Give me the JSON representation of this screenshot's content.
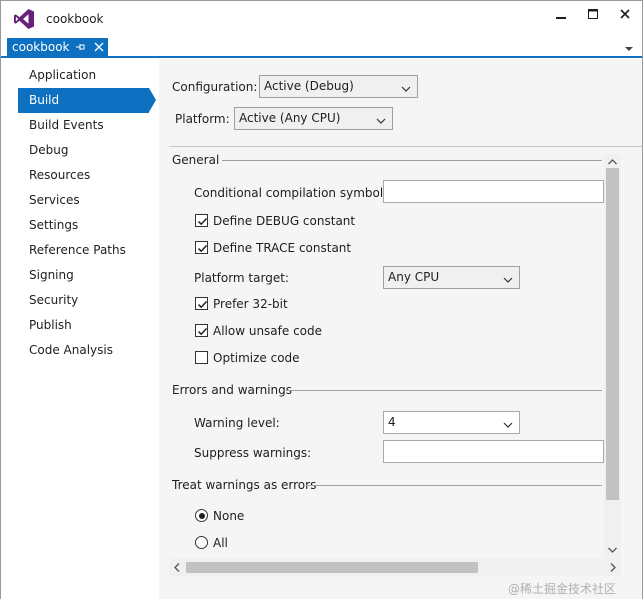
{
  "window": {
    "title": "cookbook",
    "tab_label": "cookbook",
    "accent_color": "#0e70c0"
  },
  "icons": {
    "logo": "visual-studio-logo-icon",
    "minimize": "minimize-icon",
    "maximize": "maximize-icon",
    "close": "close-icon",
    "pin": "pin-icon",
    "tab_close": "close-icon",
    "dropdown": "chevron-down-icon"
  },
  "sidebar": {
    "items": [
      {
        "label": "Application",
        "active": false
      },
      {
        "label": "Build",
        "active": true
      },
      {
        "label": "Build Events",
        "active": false
      },
      {
        "label": "Debug",
        "active": false
      },
      {
        "label": "Resources",
        "active": false
      },
      {
        "label": "Services",
        "active": false
      },
      {
        "label": "Settings",
        "active": false
      },
      {
        "label": "Reference Paths",
        "active": false
      },
      {
        "label": "Signing",
        "active": false
      },
      {
        "label": "Security",
        "active": false
      },
      {
        "label": "Publish",
        "active": false
      },
      {
        "label": "Code Analysis",
        "active": false
      }
    ]
  },
  "build": {
    "configuration_label": "Configuration:",
    "configuration_value": "Active (Debug)",
    "platform_label": "Platform:",
    "platform_value": "Active (Any CPU)",
    "general": {
      "header": "General",
      "symbols_label": "Conditional compilation symbols:",
      "symbols_value": "",
      "define_debug_label": "Define DEBUG constant",
      "define_debug_checked": true,
      "define_trace_label": "Define TRACE constant",
      "define_trace_checked": true,
      "platform_target_label": "Platform target:",
      "platform_target_value": "Any CPU",
      "prefer32_label": "Prefer 32-bit",
      "prefer32_checked": true,
      "unsafe_label": "Allow unsafe code",
      "unsafe_checked": true,
      "optimize_label": "Optimize code",
      "optimize_checked": false
    },
    "errors": {
      "header": "Errors and warnings",
      "warning_level_label": "Warning level:",
      "warning_level_value": "4",
      "suppress_label": "Suppress warnings:",
      "suppress_value": ""
    },
    "treat": {
      "header": "Treat warnings as errors",
      "none_label": "None",
      "none_selected": true,
      "all_label": "All",
      "all_selected": false
    }
  },
  "watermark": "@稀土掘金技术社区"
}
